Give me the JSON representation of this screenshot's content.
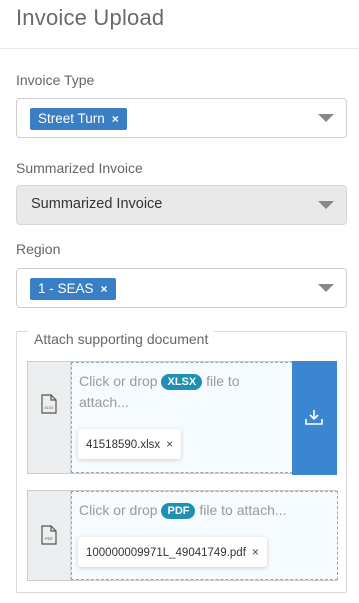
{
  "header": {
    "title": "Invoice Upload"
  },
  "invoice_type": {
    "label": "Invoice Type",
    "tag": "Street Turn",
    "remove_glyph": "×"
  },
  "summarized": {
    "label": "Summarized Invoice",
    "value": "Summarized Invoice"
  },
  "region": {
    "label": "Region",
    "tag": "1 - SEAS",
    "remove_glyph": "×"
  },
  "attach": {
    "legend": "Attach supporting document",
    "xlsx": {
      "prompt_before": "Click or drop",
      "badge": "XLSX",
      "prompt_after": "file to attach...",
      "file_icon_text": "XLSX",
      "file_name": "41518590.xlsx",
      "remove_glyph": "×",
      "upload_icon": "download-icon"
    },
    "pdf": {
      "prompt_before": "Click or drop",
      "badge": "PDF",
      "prompt_after": "file to attach...",
      "file_icon_text": "PDF",
      "file_name": "100000009971L_49041749.pdf",
      "remove_glyph": "×"
    }
  },
  "colors": {
    "tag_bg": "#3a7fc4",
    "badge_bg": "#1f8fb4",
    "upload_btn": "#3a86d0"
  }
}
